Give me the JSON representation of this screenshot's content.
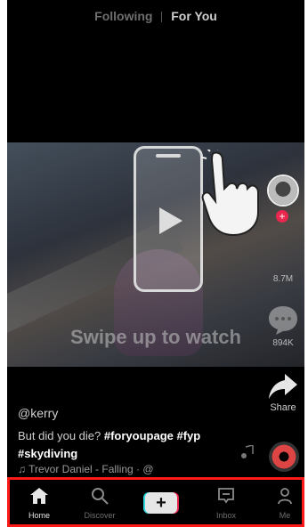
{
  "header": {
    "tabs": [
      {
        "label": "Following"
      },
      {
        "label": "For You"
      }
    ]
  },
  "overlay": {
    "instruction": "Swipe up to watch",
    "icons": [
      "phone-outline-icon",
      "play-icon",
      "hand-pointer-icon"
    ]
  },
  "sidebar": {
    "likes": "8.7M",
    "comments": "894K",
    "share_label": "Share"
  },
  "caption": {
    "username": "@kerry",
    "text_prefix": "But did you die? ",
    "hashtags_line1": "#foryoupage #fyp",
    "hashtags_line2": "#skydiving",
    "music": "♫ Trevor Daniel - Falling · @"
  },
  "nav": {
    "items": [
      {
        "label": "Home",
        "icon": "home-icon"
      },
      {
        "label": "Discover",
        "icon": "search-icon"
      },
      {
        "label": "",
        "icon": "plus-icon"
      },
      {
        "label": "Inbox",
        "icon": "inbox-icon"
      },
      {
        "label": "Me",
        "icon": "person-icon"
      }
    ]
  },
  "colors": {
    "highlight_border": "#ff1a1a",
    "accent_red": "#e8274f",
    "accent_cyan": "#33d6e0"
  }
}
